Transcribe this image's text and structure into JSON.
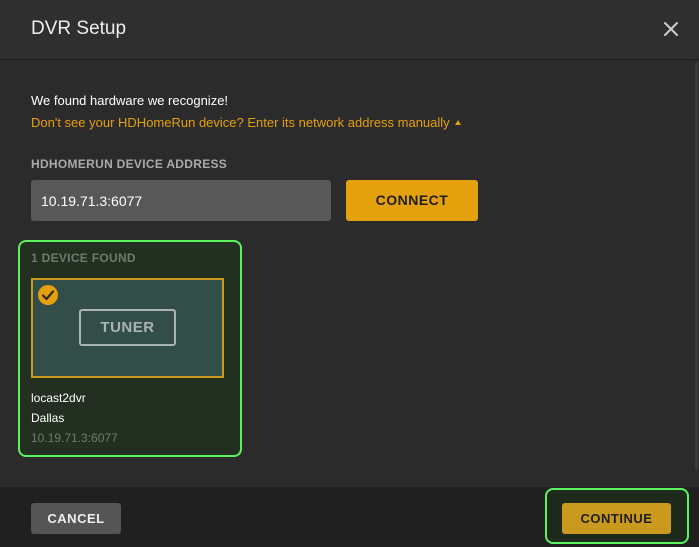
{
  "dialog": {
    "title": "DVR Setup",
    "close_icon": "close-icon"
  },
  "intro": {
    "found_text": "We found hardware we recognize!",
    "manual_link": "Don't see your HDHomeRun device? Enter its network address manually"
  },
  "address": {
    "label": "HDHOMERUN DEVICE ADDRESS",
    "value": "10.19.71.3:6077",
    "connect_label": "CONNECT"
  },
  "devices": {
    "count_label": "1 DEVICE FOUND",
    "items": [
      {
        "card_label": "TUNER",
        "selected": true,
        "name": "locast2dvr",
        "location": "Dallas",
        "address": "10.19.71.3:6077"
      }
    ]
  },
  "footer": {
    "cancel_label": "CANCEL",
    "continue_label": "CONTINUE"
  },
  "colors": {
    "accent": "#e5a00d",
    "highlight": "#5ef25e",
    "background": "#2b2b2b"
  }
}
